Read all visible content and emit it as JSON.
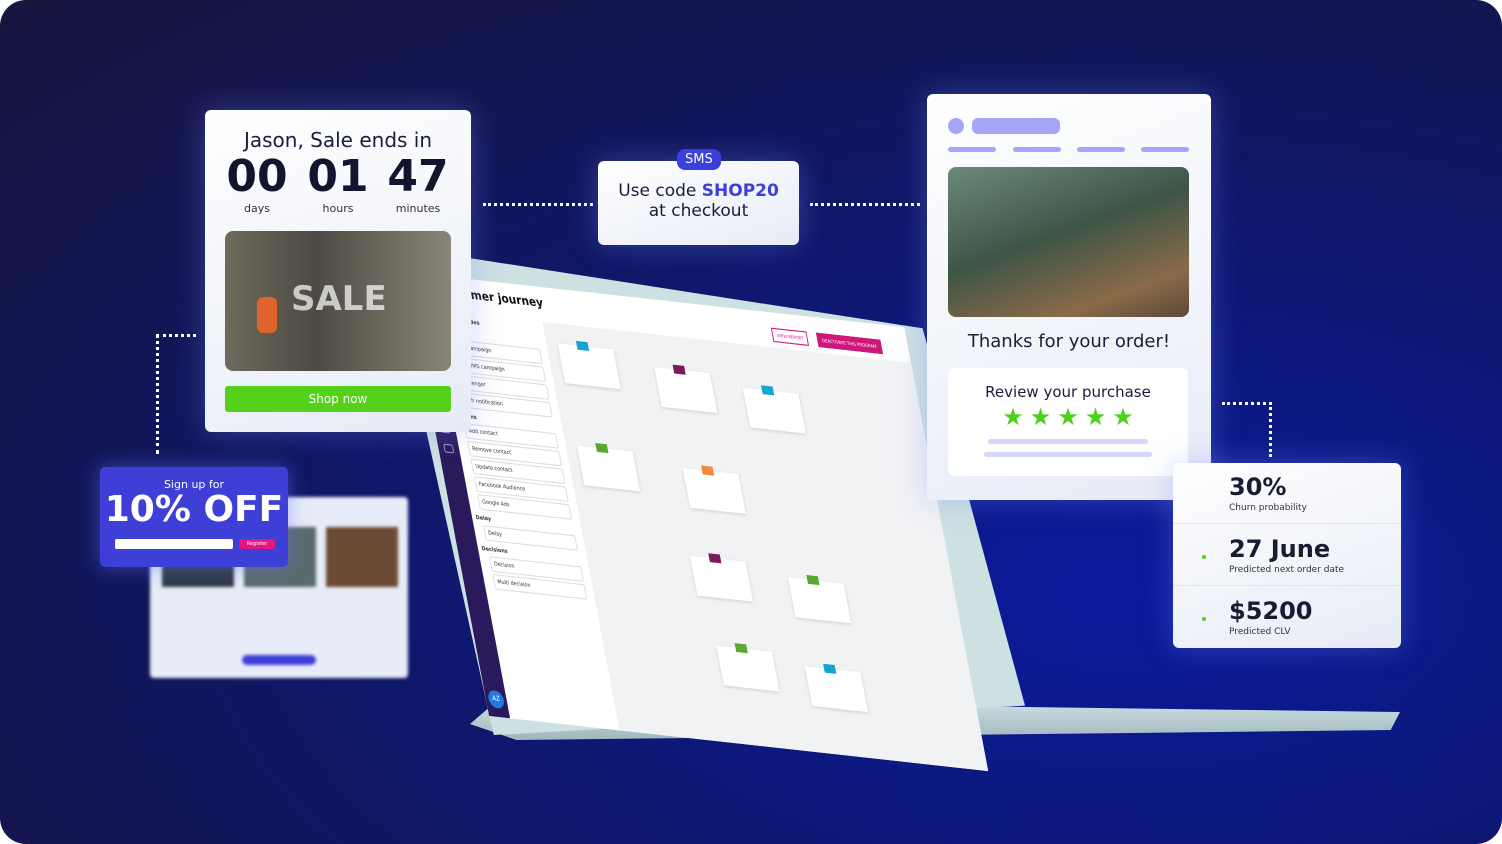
{
  "countdown": {
    "title": "Jason, Sale ends in",
    "units": [
      {
        "value": "00",
        "label": "days"
      },
      {
        "value": "01",
        "label": "hours"
      },
      {
        "value": "47",
        "label": "minutes"
      }
    ],
    "image_text": "SALE",
    "button": "Shop now"
  },
  "sms": {
    "badge": "SMS",
    "line1_prefix": "Use code ",
    "code": "SHOP20",
    "line2": "at checkout"
  },
  "signup": {
    "small": "Sign up for",
    "big": "10% OFF",
    "button": "Register"
  },
  "app": {
    "title": "Customer journey",
    "view_report": "VIEW REPORT",
    "deactivate": "DEACTIVATE THIS PROGRAM",
    "avatar": "AZ",
    "sidebar": {
      "header": "Program nodes",
      "sections": [
        {
          "title": "Messaging",
          "items": [
            "Email campaign",
            "SMS/MMS campaign",
            "Messenger",
            "Push notification"
          ]
        },
        {
          "title": "Actions",
          "items": [
            "Add contact",
            "Remove contact",
            "Update contact",
            "Facebook Audience",
            "Google Ads"
          ]
        },
        {
          "title": "Delay",
          "items": [
            "Delay"
          ]
        },
        {
          "title": "Decisions",
          "items": [
            "Decision",
            "Multi decision"
          ]
        }
      ]
    }
  },
  "order": {
    "thanks": "Thanks for your order!",
    "review": "Review your purchase",
    "rating": 5
  },
  "stats": [
    {
      "value": "30%",
      "label": "Churn probability"
    },
    {
      "value": "27 June",
      "label": "Predicted next order date"
    },
    {
      "value": "$5200",
      "label": "Predicted CLV"
    }
  ],
  "colors": {
    "accent": "#3b3fdc",
    "green": "#4bd11a",
    "pink": "#d0167a",
    "bg": "#141650"
  }
}
